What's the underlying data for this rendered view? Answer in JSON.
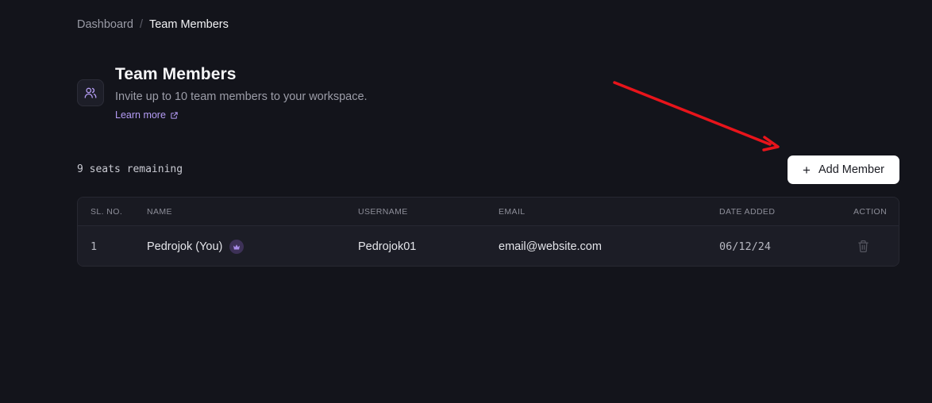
{
  "breadcrumb": {
    "parent": "Dashboard",
    "separator": "/",
    "current": "Team Members"
  },
  "header": {
    "icon": "users-icon",
    "title": "Team Members",
    "subtitle": "Invite up to 10 team members to your workspace.",
    "learn_more": "Learn more",
    "learn_more_icon": "external-link-icon"
  },
  "seats_remaining": "9 seats remaining",
  "add_member_button": {
    "icon": "plus-icon",
    "label": "Add Member"
  },
  "annotation": {
    "arrow_color": "#e8141b"
  },
  "table": {
    "columns": [
      "SL. NO.",
      "NAME",
      "USERNAME",
      "EMAIL",
      "DATE ADDED",
      "ACTION"
    ],
    "rows": [
      {
        "sl_no": "1",
        "name": "Pedrojok (You)",
        "badge_icon": "crown-icon",
        "username": "Pedrojok01",
        "email": "email@website.com",
        "date_added": "06/12/24",
        "action_icon": "trash-icon"
      }
    ]
  },
  "colors": {
    "background": "#13141b",
    "accent": "#b59cf5",
    "button_bg": "#ffffff"
  }
}
